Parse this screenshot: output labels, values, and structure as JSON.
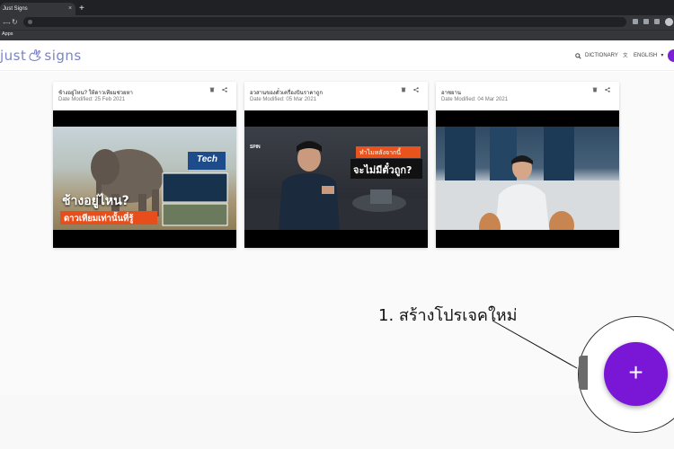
{
  "browser": {
    "tab_title": "Just Signs",
    "tab_close": "×",
    "new_tab": "+",
    "back": "←",
    "forward": "→",
    "reload": "↻",
    "bookmarks_label": "Apps"
  },
  "header": {
    "logo_left": "just",
    "logo_right": "signs",
    "dictionary_label": "DICTIONARY",
    "language_label": "ENGLISH",
    "language_caret": "▾"
  },
  "cards": [
    {
      "title": "ช้างอยู่ไหน? ให้ดาวเทียมช่วยหา",
      "date": "Date Modified: 25 Feb 2021",
      "thumb_line1": "ช้างอยู่ไหน?",
      "thumb_line2": "ดาวเทียมเท่านั้นที่รู้",
      "badge": "Tech"
    },
    {
      "title": "อวสานของตั๋วเครื่องบินราคาถูก",
      "date": "Date Modified: 05 Mar 2021",
      "thumb_line1": "ทำไมหลังจากนี้",
      "thumb_line2": "จะไม่มีตั๋วถูก?",
      "badge": "SPIN"
    },
    {
      "title": "อาชยาน",
      "date": "Date Modified: 04 Mar 2021",
      "thumb_line1": "",
      "thumb_line2": "",
      "badge": ""
    }
  ],
  "annotation": {
    "callout_text": "1. สร้างโปรเจคใหม่"
  },
  "fab": {
    "label": "+"
  },
  "colors": {
    "accent": "#7a17d6",
    "logo": "#7b83c9"
  }
}
